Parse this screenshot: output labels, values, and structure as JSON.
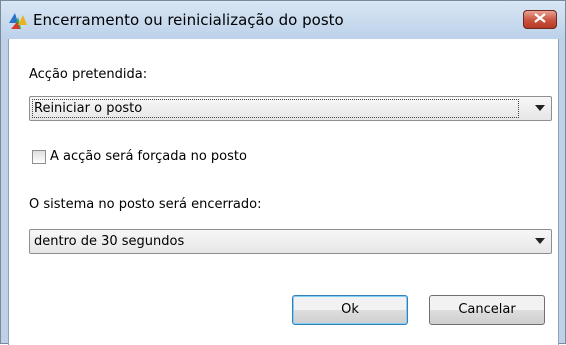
{
  "window": {
    "title": "Encerramento ou reinicialização do posto",
    "close_icon": "close-x-icon",
    "app_icon": "avg-logo-icon"
  },
  "form": {
    "action_label": "Acção pretendida:",
    "action_value": "Reiniciar o posto",
    "force_label": "A acção será forçada no posto",
    "force_checked": false,
    "timing_label": "O sistema no posto será encerrado:",
    "timing_value": "dentro de 30 segundos"
  },
  "buttons": {
    "ok": "Ok",
    "cancel": "Cancelar"
  }
}
